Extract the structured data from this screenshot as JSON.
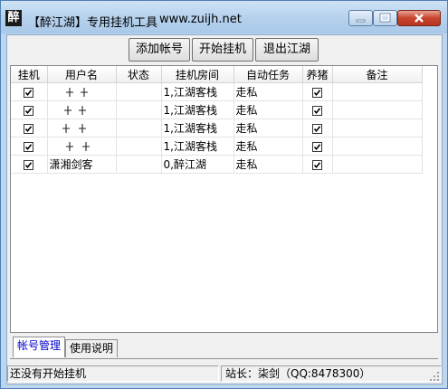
{
  "window": {
    "title": "【醉江湖】专用挂机工具",
    "url": "www.zuijh.net",
    "icon_text": "醉",
    "controls": [
      "minimize-icon",
      "maximize-icon",
      "close-icon"
    ]
  },
  "toolbar": {
    "add_account": "添加帐号",
    "start": "开始挂机",
    "exit": "退出江湖"
  },
  "table": {
    "headers": [
      "挂机",
      "用户名",
      "状态",
      "挂机房间",
      "自动任务",
      "养猪",
      "备注"
    ],
    "rows": [
      {
        "hang": true,
        "username": "",
        "status": "",
        "room": "1,江湖客栈",
        "task": "走私",
        "pig": true,
        "note": ""
      },
      {
        "hang": true,
        "username": "",
        "status": "",
        "room": "1,江湖客栈",
        "task": "走私",
        "pig": true,
        "note": ""
      },
      {
        "hang": true,
        "username": "",
        "status": "",
        "room": "1,江湖客栈",
        "task": "走私",
        "pig": true,
        "note": ""
      },
      {
        "hang": true,
        "username": "",
        "status": "",
        "room": "1,江湖客栈",
        "task": "走私",
        "pig": true,
        "note": ""
      },
      {
        "hang": true,
        "username": "潇湘剑客",
        "status": "",
        "room": "0,醉江湖",
        "task": "走私",
        "pig": true,
        "note": ""
      }
    ]
  },
  "tabs": [
    "帐号管理",
    "使用说明"
  ],
  "status": {
    "left": "还没有开始挂机",
    "right": "站长：柒剑（QQ:8478300）"
  },
  "colors": {
    "accent": "#0000cc",
    "close": "#c7442d",
    "titlebar": "#b4d0ec"
  }
}
